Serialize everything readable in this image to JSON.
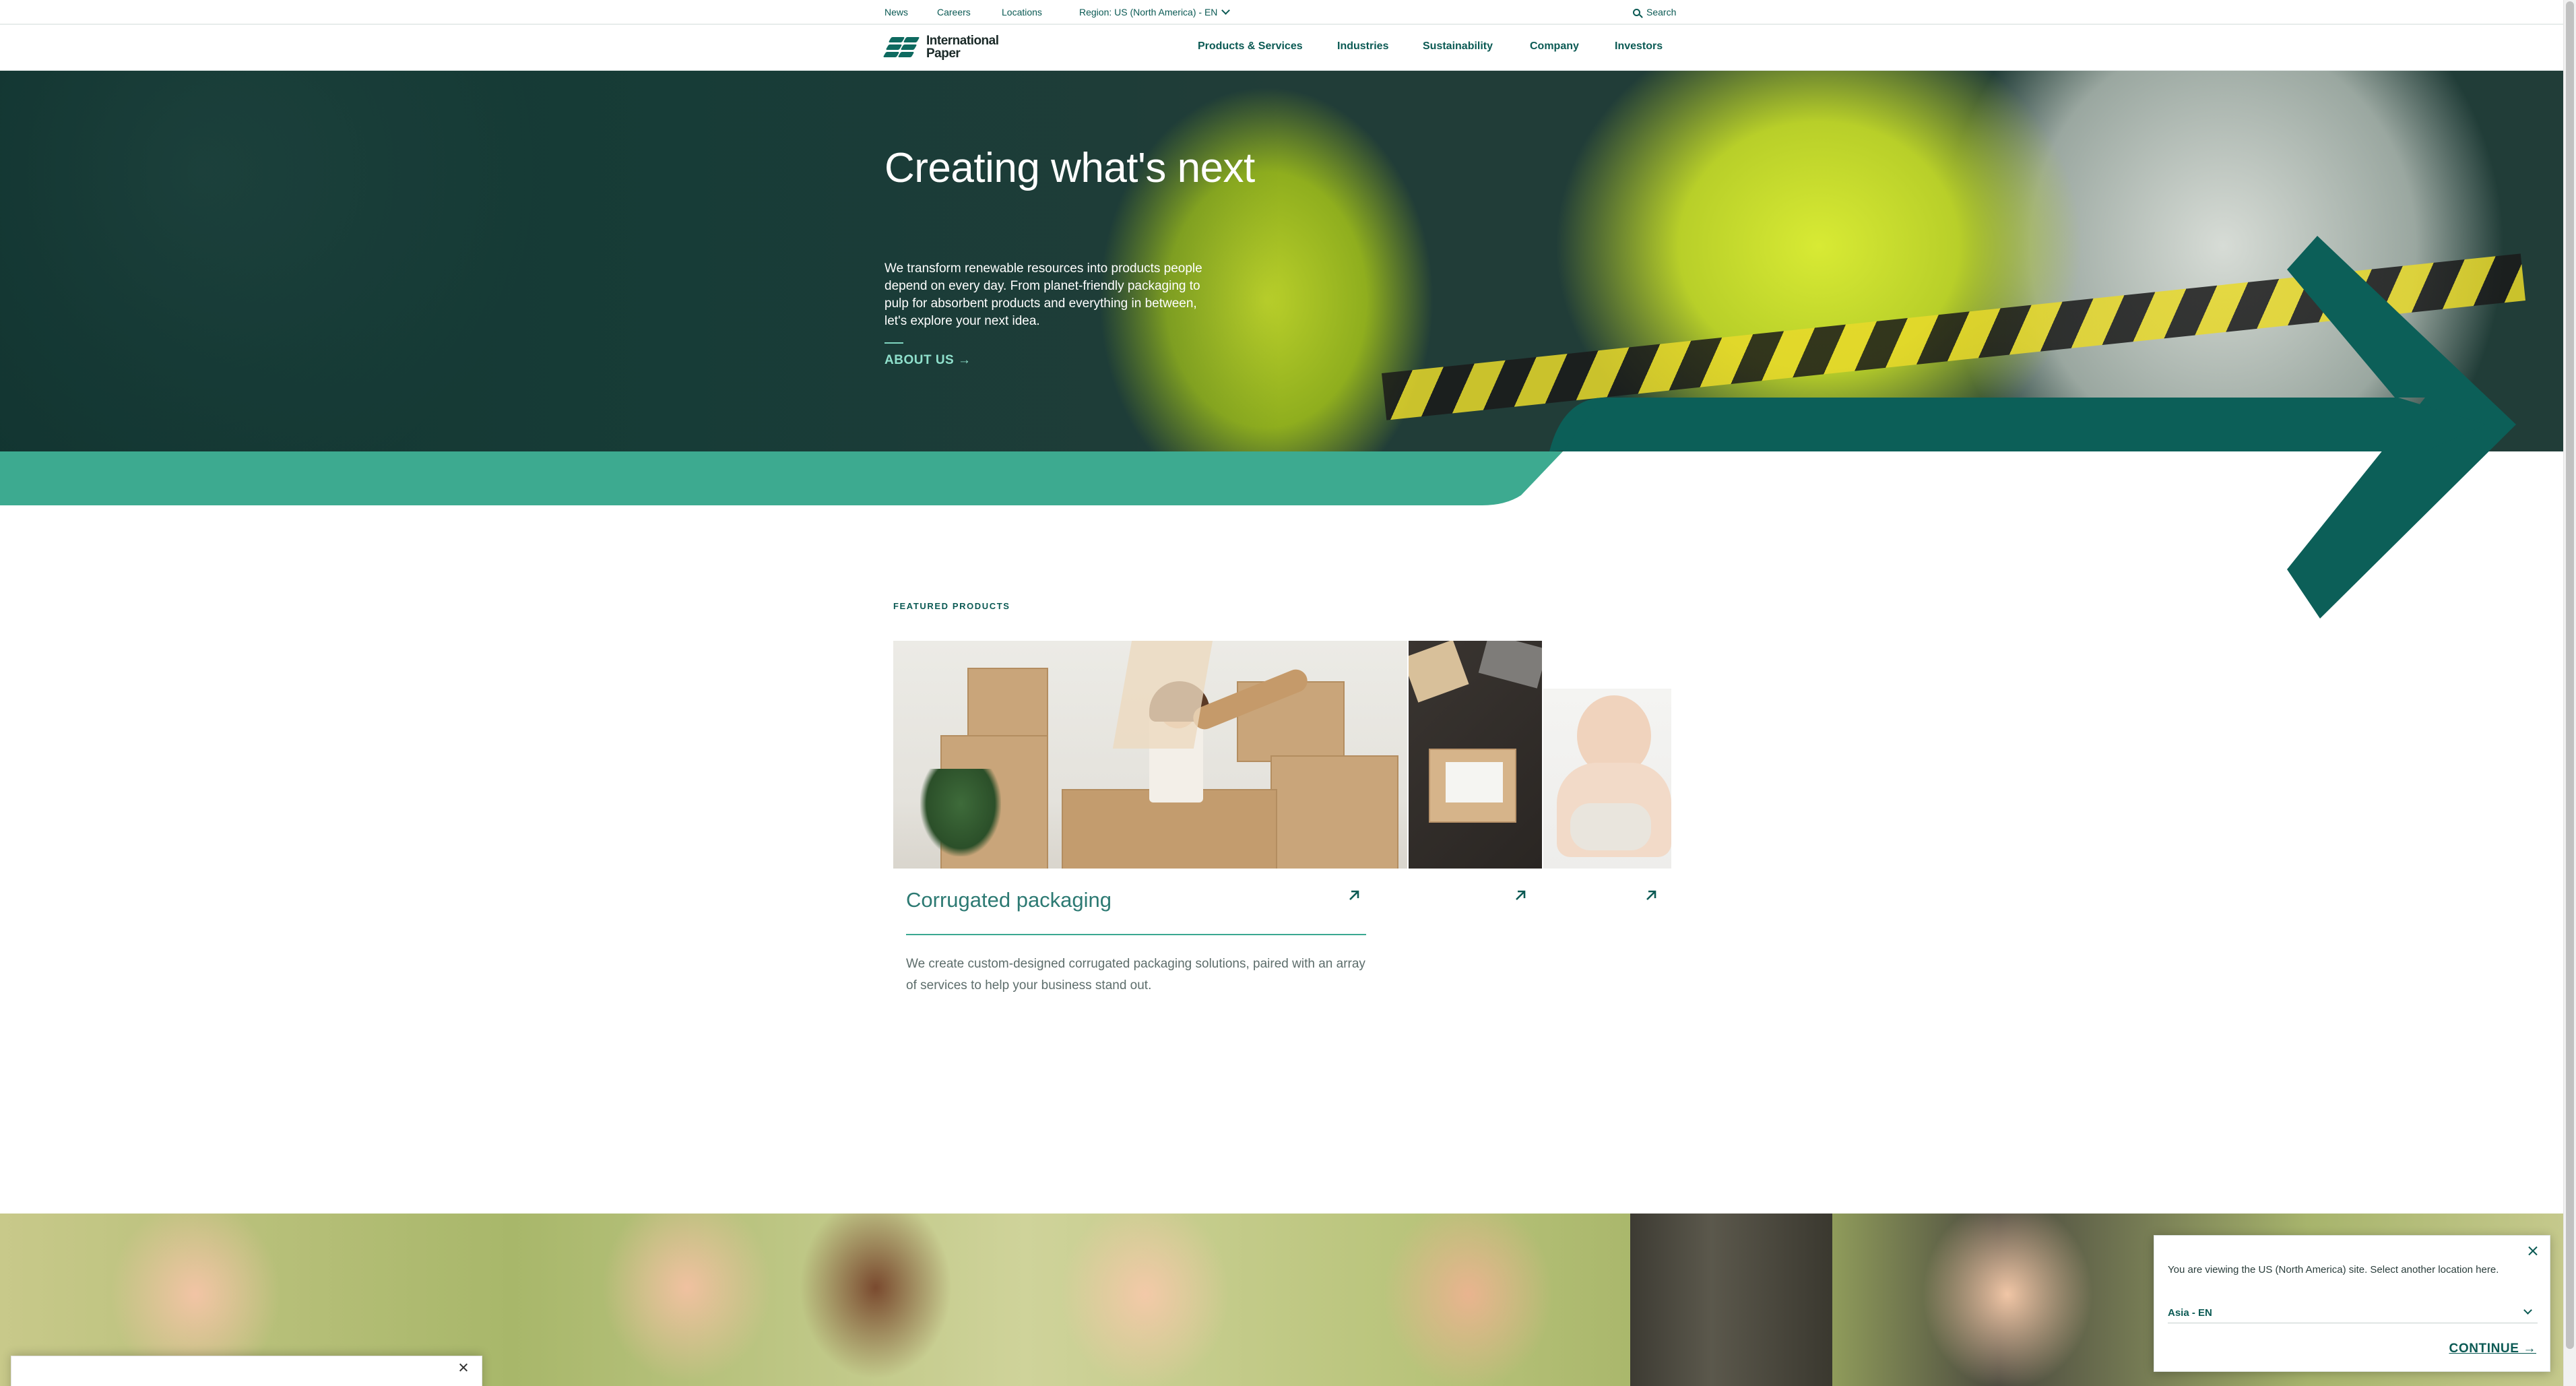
{
  "utility": {
    "news": "News",
    "careers": "Careers",
    "locations": "Locations",
    "region": "Region: US (North America) - EN",
    "search": "Search"
  },
  "brand": {
    "name_line1": "International",
    "name_line2": "Paper"
  },
  "nav": {
    "items": [
      {
        "label": "Products & Services"
      },
      {
        "label": "Industries"
      },
      {
        "label": "Sustainability"
      },
      {
        "label": "Company"
      },
      {
        "label": "Investors"
      }
    ]
  },
  "hero": {
    "title": "Creating what's next",
    "body": "We transform renewable resources into products people depend on every day. From planet-friendly packaging to pulp for absorbent products and everything in between, let's explore your next idea.",
    "cta": "ABOUT US →"
  },
  "featured": {
    "label": "FEATURED PRODUCTS",
    "cards": [
      {
        "title": "Corrugated packaging",
        "description": "We create custom-designed corrugated packaging solutions, paired with an array of services to help your business stand out."
      }
    ]
  },
  "region_modal": {
    "message": "You are viewing the US (North America) site. Select another location here.",
    "selected": "Asia - EN",
    "continue": "CONTINUE →"
  },
  "colors": {
    "brand_teal": "#0b5a54",
    "accent_teal": "#3daa90",
    "dark_arrow": "#0c5f58"
  }
}
